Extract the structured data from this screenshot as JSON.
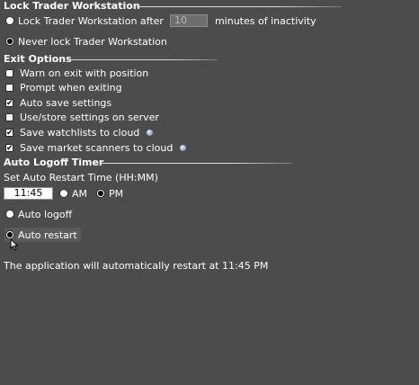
{
  "lock_section": {
    "title": "Lock Trader Workstation",
    "lock_after_label": "Lock Trader Workstation after",
    "lock_minutes_value": "10",
    "lock_after_suffix": "minutes of inactivity",
    "never_lock_label": "Never lock Trader Workstation",
    "selected": "never"
  },
  "exit_section": {
    "title": "Exit Options",
    "options": [
      {
        "label": "Warn on exit with position",
        "checked": false,
        "cloud_icon": false
      },
      {
        "label": "Prompt when exiting",
        "checked": false,
        "cloud_icon": false
      },
      {
        "label": "Auto save settings",
        "checked": true,
        "cloud_icon": false
      },
      {
        "label": "Use/store settings on server",
        "checked": false,
        "cloud_icon": false
      },
      {
        "label": "Save watchlists to cloud",
        "checked": true,
        "cloud_icon": true
      },
      {
        "label": "Save market scanners to cloud",
        "checked": true,
        "cloud_icon": true
      }
    ]
  },
  "logoff_section": {
    "title": "Auto Logoff Timer",
    "restart_time_label": "Set Auto Restart Time (HH:MM)",
    "time_value": "11:45",
    "am_label": "AM",
    "pm_label": "PM",
    "ampm_selected": "PM",
    "auto_logoff_label": "Auto logoff",
    "auto_restart_label": "Auto restart",
    "mode_selected": "restart",
    "info_text": "The application will automatically restart at 11:45 PM"
  },
  "colors": {
    "background": "#4c4c4c",
    "text": "#ffffff",
    "disabled_input": "#6e6e6e"
  },
  "icons": {
    "cloud": "cloud-sync-icon",
    "cursor": "mouse-pointer-icon"
  }
}
